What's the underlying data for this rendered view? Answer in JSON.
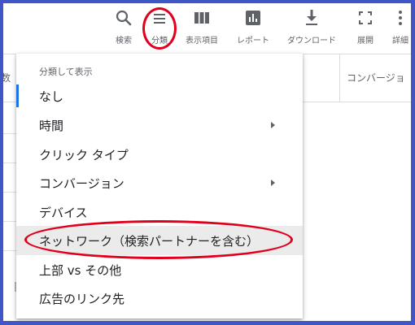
{
  "toolbar": {
    "items": [
      {
        "label": "検索",
        "icon": "search-icon"
      },
      {
        "label": "分類",
        "icon": "segment-icon"
      },
      {
        "label": "表示項目",
        "icon": "columns-icon"
      },
      {
        "label": "レポート",
        "icon": "reports-icon"
      },
      {
        "label": "ダウンロード",
        "icon": "download-icon"
      },
      {
        "label": "展開",
        "icon": "expand-icon"
      },
      {
        "label": "詳細",
        "icon": "more-icon"
      }
    ]
  },
  "table": {
    "col_left": "数",
    "col_conversion": "コンバージョ"
  },
  "menu": {
    "header": "分類して表示",
    "items": [
      {
        "label": "なし",
        "selected": true
      },
      {
        "label": "時間",
        "has_submenu": true
      },
      {
        "label": "クリック タイプ"
      },
      {
        "label": "コンバージョン",
        "has_submenu": true
      },
      {
        "label": "デバイス"
      },
      {
        "label": "ネットワーク（検索パートナーを含む）",
        "highlighted": true
      },
      {
        "label": "上部 vs その他"
      },
      {
        "label": "広告のリンク先"
      }
    ]
  },
  "annotation": {
    "color": "#e0001b",
    "circled": [
      "分類",
      "ネットワーク（検索パートナーを含む）"
    ]
  },
  "colors": {
    "frame": "#3e56c6",
    "icon": "#5f6368",
    "selection_bar": "#1a73e8",
    "hover": "#ebebeb"
  }
}
